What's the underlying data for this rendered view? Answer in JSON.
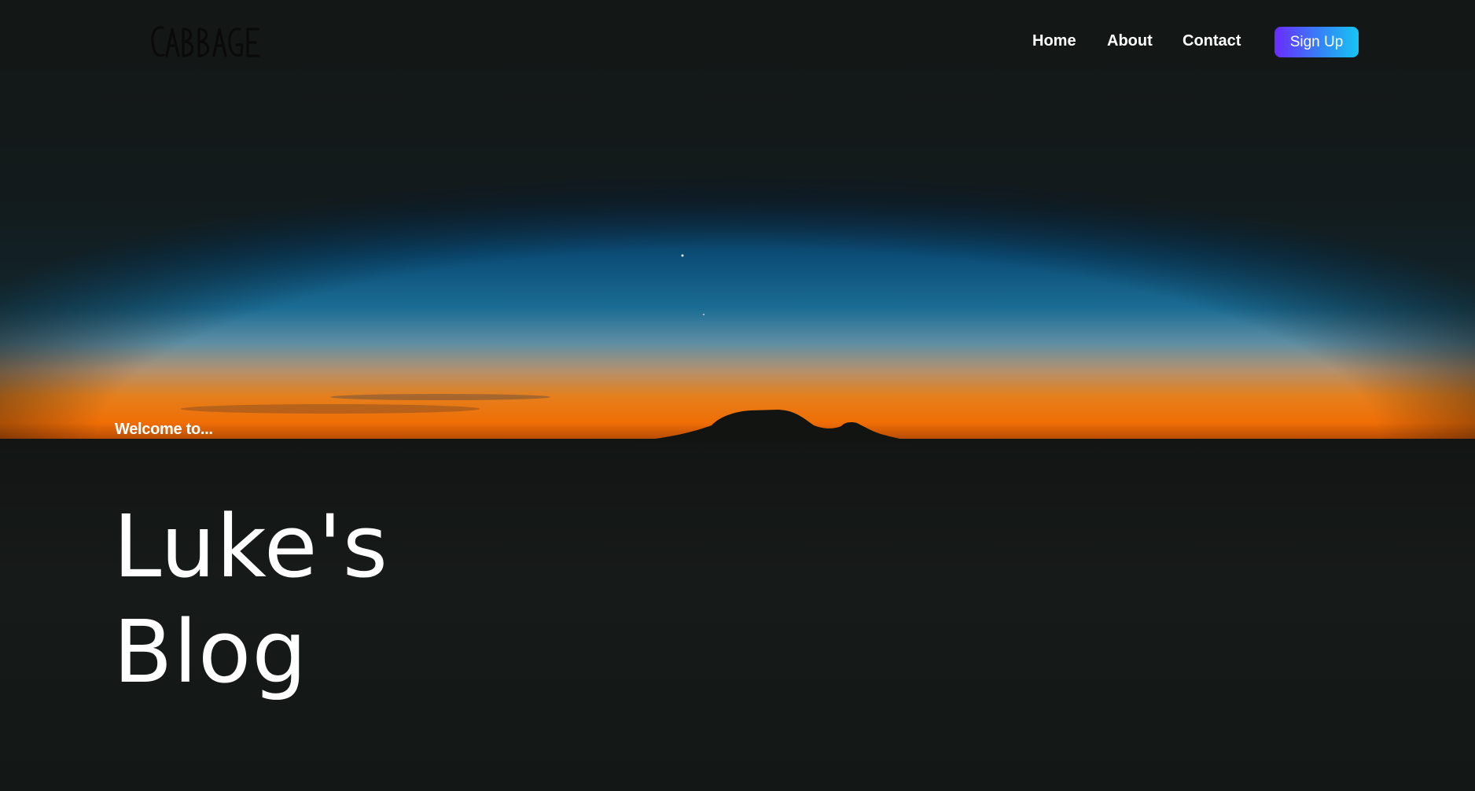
{
  "brand": {
    "logo_text": "CABBAGE",
    "logo_color": "#0a0a0a"
  },
  "nav": {
    "links": [
      {
        "label": "Home"
      },
      {
        "label": "About"
      },
      {
        "label": "Contact"
      }
    ],
    "signup_label": "Sign Up",
    "signup_gradient": [
      "#6a2bff",
      "#17c5f5"
    ]
  },
  "hero": {
    "welcome_text": "Welcome to...",
    "title_line1": "Luke's",
    "title_line2": "Blog",
    "background": "sunset-horizon-mountain-silhouette",
    "colors": {
      "sky_top": "#151a1c",
      "sky_blue": "#0e5a8a",
      "horizon_orange": "#f07a0a",
      "ground": "#131715"
    }
  }
}
